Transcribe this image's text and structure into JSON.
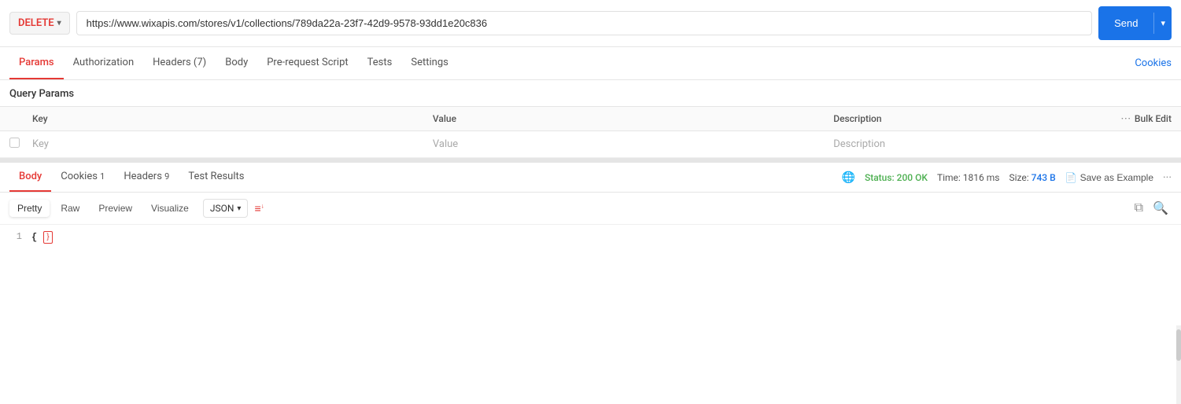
{
  "header": {
    "method": "DELETE",
    "url": "https://www.wixapis.com/stores/v1/collections/789da22a-23f7-42d9-9578-93dd1e20c836",
    "send_label": "Send",
    "chevron": "▾"
  },
  "request_tabs": [
    {
      "id": "params",
      "label": "Params",
      "active": true
    },
    {
      "id": "authorization",
      "label": "Authorization",
      "active": false
    },
    {
      "id": "headers",
      "label": "Headers (7)",
      "active": false
    },
    {
      "id": "body",
      "label": "Body",
      "active": false
    },
    {
      "id": "pre-request-script",
      "label": "Pre-request Script",
      "active": false
    },
    {
      "id": "tests",
      "label": "Tests",
      "active": false
    },
    {
      "id": "settings",
      "label": "Settings",
      "active": false
    }
  ],
  "cookies_link": "Cookies",
  "query_params": {
    "title": "Query Params",
    "columns": [
      "Key",
      "Value",
      "Description"
    ],
    "bulk_edit": "Bulk Edit",
    "placeholder_row": {
      "key": "Key",
      "value": "Value",
      "description": "Description"
    }
  },
  "response": {
    "tabs": [
      {
        "id": "body",
        "label": "Body",
        "active": true
      },
      {
        "id": "cookies",
        "label": "Cookies",
        "badge": "1",
        "active": false
      },
      {
        "id": "headers",
        "label": "Headers",
        "badge": "9",
        "active": false
      },
      {
        "id": "test-results",
        "label": "Test Results",
        "active": false
      }
    ],
    "status": "Status: 200 OK",
    "time": "Time: 1816 ms",
    "size": "Size:",
    "size_value": "743 B",
    "save_example": "Save as Example",
    "format_buttons": [
      {
        "id": "pretty",
        "label": "Pretty",
        "active": true
      },
      {
        "id": "raw",
        "label": "Raw",
        "active": false
      },
      {
        "id": "preview",
        "label": "Preview",
        "active": false
      },
      {
        "id": "visualize",
        "label": "Visualize",
        "active": false
      }
    ],
    "json_label": "JSON",
    "code": {
      "line_number": "1",
      "content": "{ }"
    }
  }
}
